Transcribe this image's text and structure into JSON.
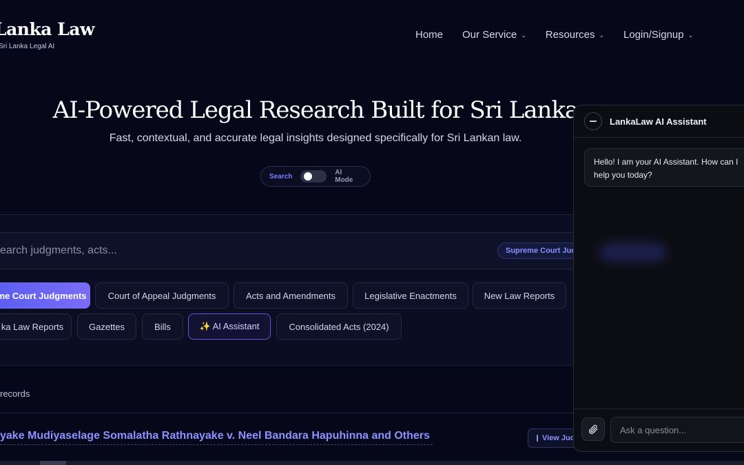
{
  "brand": {
    "title": "Lanka Law",
    "subtitle": "Sri Lanka Legal AI"
  },
  "nav": {
    "home": "Home",
    "service": "Our Service",
    "resources": "Resources",
    "login": "Login/Signup",
    "chevron_icon": "chevron-down-icon"
  },
  "hero": {
    "title": "AI-Powered Legal Research Built for Sri Lanka",
    "subtitle": "Fast, contextual, and accurate legal insights designed specifically for Sri Lankan law."
  },
  "mode_toggle": {
    "left_label": "Search",
    "right_label": "AI Mode",
    "selected": "Search"
  },
  "search": {
    "placeholder": "earch judgments, acts...",
    "scope_chip": "Supreme Court Judgments"
  },
  "categories": [
    {
      "label": "me Court Judgments",
      "active": true
    },
    {
      "label": "Court of Appeal Judgments",
      "active": false
    },
    {
      "label": "Acts and Amendments",
      "active": false
    },
    {
      "label": "Legislative Enactments",
      "active": false
    },
    {
      "label": "New Law Reports",
      "active": false
    },
    {
      "label": "ka Law Reports",
      "active": false
    },
    {
      "label": "Gazettes",
      "active": false
    },
    {
      "label": "Bills",
      "active": false
    },
    {
      "label": "✨ AI Assistant",
      "active": false
    },
    {
      "label": "Consolidated Acts (2024)",
      "active": false
    }
  ],
  "results": {
    "records_label": "records",
    "items": [
      {
        "title": "yake Mudiyaselage Somalatha Rathnayake v. Neel Bandara Hapuhinna and Others",
        "action": "View Judgment"
      }
    ]
  },
  "chat": {
    "title": "LankaLaw AI Assistant",
    "messages": [
      {
        "role": "assistant",
        "text": "Hello! I am your AI Assistant. How can I help you today?"
      }
    ],
    "input_placeholder": "Ask a question...",
    "attach_icon": "paperclip-icon",
    "minimize_icon": "minimize-icon"
  },
  "colors": {
    "background": "#06081a",
    "accent": "#6f6cf5",
    "link": "#8d92ff"
  }
}
